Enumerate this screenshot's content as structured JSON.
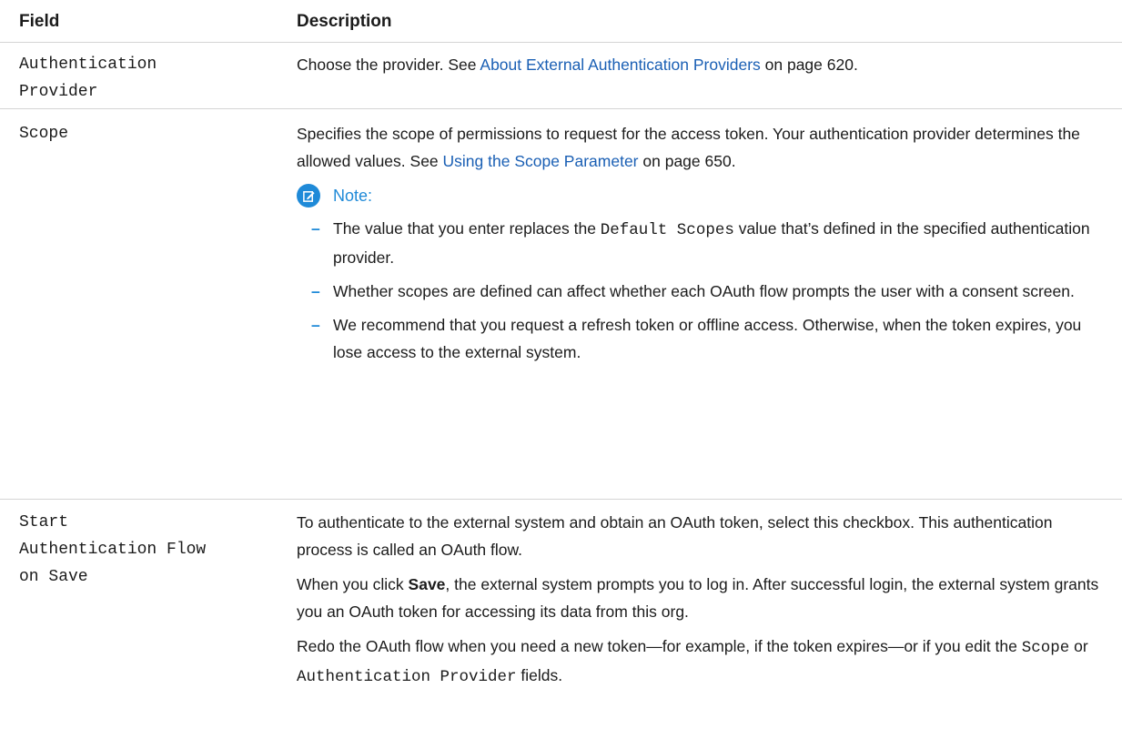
{
  "headers": {
    "field": "Field",
    "description": "Description"
  },
  "rows": [
    {
      "field": "Authentication\nProvider",
      "desc_before": "Choose the provider. See ",
      "link": "About External Authentication Providers",
      "desc_after": " on page 620."
    },
    {
      "field": "Scope",
      "desc_before": "Specifies the scope of permissions to request for the access token. Your authentication provider determines the allowed values. See ",
      "link": "Using the Scope Parameter",
      "desc_after": " on page 650.",
      "note_label": "Note:",
      "bullets": [
        {
          "before": "The value that you enter replaces the ",
          "code": "Default Scopes",
          "after": " value that’s defined in the specified authentication provider."
        },
        {
          "text": "Whether scopes are defined can affect whether each OAuth flow prompts the user with a consent screen."
        },
        {
          "text": "We recommend that you request a refresh token or offline access. Otherwise, when the token expires, you lose access to the external system."
        }
      ]
    },
    {
      "field": "Start\nAuthentication Flow\non Save",
      "para1": "To authenticate to the external system and obtain an OAuth token, select this checkbox. This authentication process is called an OAuth flow.",
      "para2_before": "When you click ",
      "para2_bold": "Save",
      "para2_after": ", the external system prompts you to log in. After successful login, the external system grants you an OAuth token for accessing its data from this org.",
      "para3_before": "Redo the OAuth flow when you need a new token—for example, if the token expires—or if you edit the ",
      "para3_code1": "Scope",
      "para3_mid": " or ",
      "para3_code2": "Authentication Provider",
      "para3_after": " fields."
    }
  ],
  "icons": {
    "note": "edit-note-icon"
  },
  "colors": {
    "link": "#1a5fb4",
    "accent": "#1f8ad8",
    "divider": "#d4d4d4"
  }
}
